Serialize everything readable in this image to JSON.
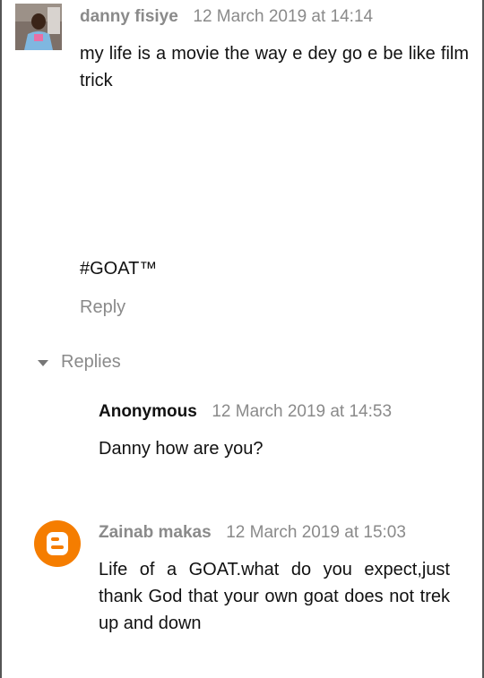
{
  "comment": {
    "author": "danny fisiye",
    "timestamp": "12 March 2019 at 14:14",
    "text": "my life is a movie the way e dey go e be like film trick",
    "tag": "#GOAT™",
    "reply_label": "Reply"
  },
  "replies_toggle": {
    "label": "Replies"
  },
  "replies": [
    {
      "author": "Anonymous",
      "timestamp": "12 March 2019 at 14:53",
      "text": "Danny how are you?"
    },
    {
      "author": "Zainab makas",
      "timestamp": "12 March 2019 at 15:03",
      "text": "Life of a GOAT.what do you expect,just thank God that your own goat does not trek up and down"
    }
  ],
  "icons": {
    "caret": "caret-down-icon",
    "blogger": "blogger-logo-icon"
  },
  "colors": {
    "blogger_orange": "#F57D00",
    "muted_text": "#8a8a8a"
  }
}
